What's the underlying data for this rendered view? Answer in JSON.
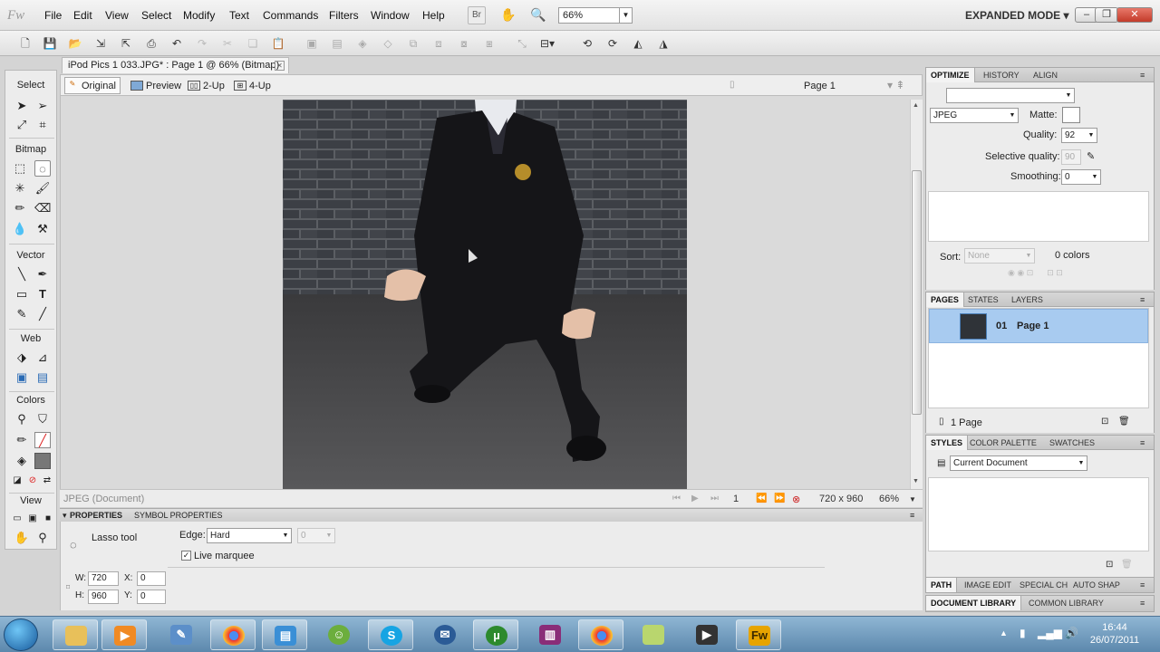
{
  "app": {
    "logo": "Fw",
    "menus": [
      "File",
      "Edit",
      "View",
      "Select",
      "Modify",
      "Text",
      "Commands",
      "Filters",
      "Window",
      "Help"
    ],
    "zoom": "66%",
    "bridge_label": "Br",
    "mode": "EXPANDED MODE"
  },
  "tools": {
    "select_header": "Select",
    "bitmap_header": "Bitmap",
    "vector_header": "Vector",
    "web_header": "Web",
    "colors_header": "Colors",
    "view_header": "View",
    "text_tool": "T"
  },
  "document": {
    "tab_title": "iPod Pics 1 033.JPG* : Page 1 @  66% (Bitmap)",
    "views": [
      "Original",
      "Preview",
      "2-Up",
      "4-Up"
    ],
    "page": "Page 1"
  },
  "status": {
    "format": "JPEG (Document)",
    "frame": "1",
    "dimensions": "720 x 960",
    "zoom": "66%"
  },
  "properties": {
    "tabs": [
      "PROPERTIES",
      "SYMBOL PROPERTIES"
    ],
    "tool_name": "Lasso tool",
    "edge_label": "Edge:",
    "edge_value": "Hard",
    "feather_value": "0",
    "live_marquee": "Live marquee",
    "w_label": "W:",
    "w_value": "720",
    "h_label": "H:",
    "h_value": "960",
    "x_label": "X:",
    "x_value": "0",
    "y_label": "Y:",
    "y_value": "0"
  },
  "optimize": {
    "tabs": [
      "OPTIMIZE",
      "HISTORY",
      "ALIGN"
    ],
    "preset": "",
    "format": "JPEG",
    "matte_label": "Matte:",
    "quality_label": "Quality:",
    "quality": "92",
    "selective_label": "Selective quality:",
    "selective": "90",
    "smoothing_label": "Smoothing:",
    "smoothing": "0",
    "sort_label": "Sort:",
    "sort": "None",
    "colors": "0 colors"
  },
  "pages": {
    "tabs": [
      "PAGES",
      "STATES",
      "LAYERS"
    ],
    "item_number": "01",
    "item_name": "Page 1",
    "count": "1 Page"
  },
  "styles": {
    "tabs": [
      "STYLES",
      "COLOR PALETTE",
      "SWATCHES"
    ],
    "selected": "Current Document"
  },
  "bottom_tabs": {
    "row1": [
      "PATH",
      "IMAGE EDIT",
      "SPECIAL CH",
      "AUTO SHAP"
    ],
    "row2": [
      "DOCUMENT LIBRARY",
      "COMMON LIBRARY"
    ]
  },
  "taskbar": {
    "time": "16:44",
    "date": "26/07/2011",
    "fireworks_label": "Fw"
  }
}
